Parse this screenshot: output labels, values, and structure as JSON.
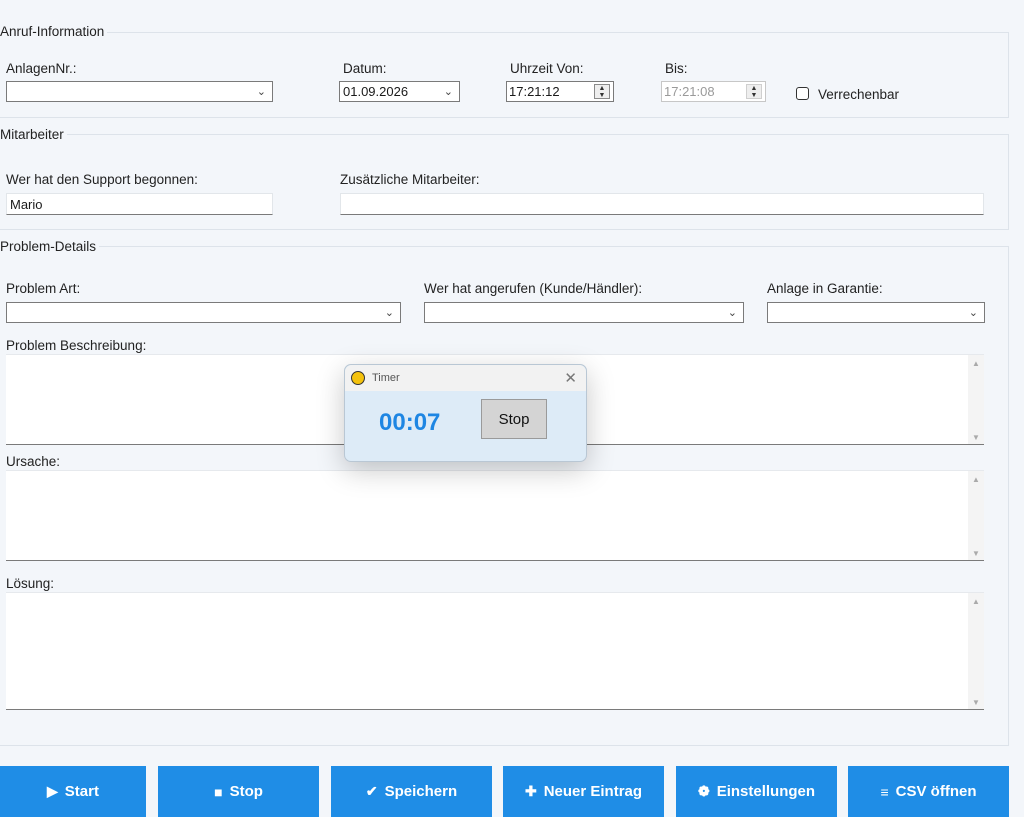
{
  "anruf": {
    "title": "Anruf-Information",
    "anlagen_label": "AnlagenNr.:",
    "anlagen_value": "",
    "datum_label": "Datum:",
    "datum_value": "01.09.2026",
    "von_label": "Uhrzeit Von:",
    "von_value": "17:21:12",
    "bis_label": "Bis:",
    "bis_value": "17:21:08",
    "verrechenbar_label": "Verrechenbar",
    "verrechenbar_checked": false
  },
  "mitarbeiter": {
    "title": "Mitarbeiter",
    "begonnen_label": "Wer hat den Support begonnen:",
    "begonnen_value": "Mario",
    "zusaetzlich_label": "Zusätzliche Mitarbeiter:",
    "zusaetzlich_value": ""
  },
  "problem": {
    "title": "Problem-Details",
    "art_label": "Problem Art:",
    "anrufer_label": "Wer hat angerufen (Kunde/Händler):",
    "garantie_label": "Anlage in Garantie:",
    "beschreibung_label": "Problem Beschreibung:",
    "ursache_label": "Ursache:",
    "loesung_label": "Lösung:"
  },
  "buttons": {
    "start": "Start",
    "stop": "Stop",
    "speichern": "Speichern",
    "neuer_eintrag": "Neuer Eintrag",
    "einstellungen": "Einstellungen",
    "csv": "CSV öffnen"
  },
  "timer": {
    "title": "Timer",
    "value": "00:07",
    "stop_label": "Stop"
  },
  "icons": {
    "start": "play-icon",
    "stop": "stop-square-icon",
    "speichern": "checkmark-icon",
    "neuer_eintrag": "plus-icon",
    "einstellungen": "gear-icon",
    "csv": "menu-lines-icon"
  },
  "colors": {
    "accent": "#1f8de6",
    "timer_value": "#1e86e3",
    "background": "#f3f6fa"
  }
}
